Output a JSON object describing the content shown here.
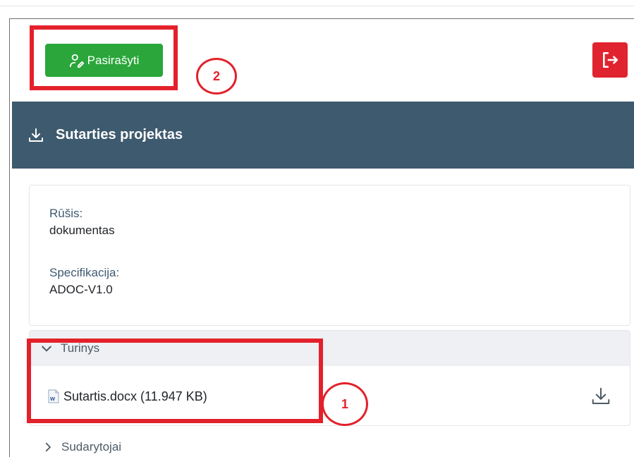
{
  "toolbar": {
    "sign_label": "Pasirašyti",
    "sign_color": "#2aa63a",
    "exit_icon": "logout-icon",
    "exit_color": "#e0242f"
  },
  "document": {
    "title": "Sutarties projektas",
    "header_color": "#3e5a6e",
    "type_label": "Rūšis:",
    "type_value": "dokumentas",
    "spec_label": "Specifikacija:",
    "spec_value": "ADOC-V1.0"
  },
  "content": {
    "section_label": "Turinys",
    "file_name": "Sutartis.docx (11.947 KB)",
    "file_icon": "word-file-icon"
  },
  "parties": {
    "section_label": "Sudarytojai"
  },
  "annotations": {
    "marker_1": "1",
    "marker_2": "2",
    "color": "#e3212b"
  }
}
